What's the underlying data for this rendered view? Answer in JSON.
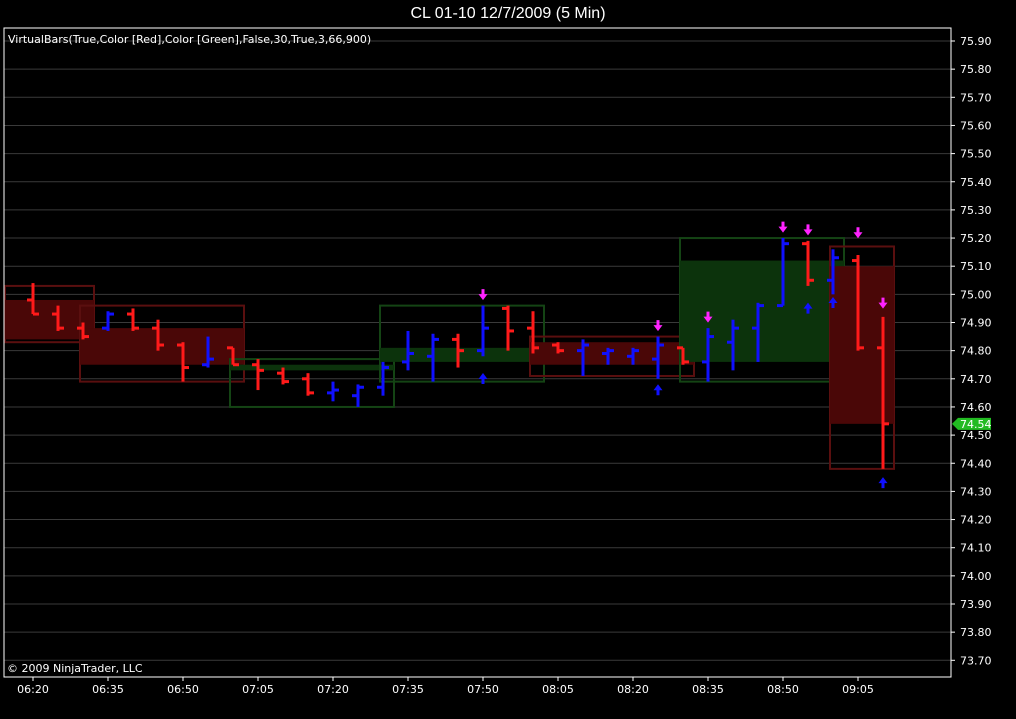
{
  "title": "CL 01-10  12/7/2009 (5 Min)",
  "indicator_label": "VirtualBars(True,Color [Red],Color [Green],False,30,True,3,66,900)",
  "copyright": "© 2009 NinjaTrader, LLC",
  "colors": {
    "background": "#000000",
    "grid": "#3a3a3a",
    "up_bar": "#1010ff",
    "down_bar": "#ff1a1a",
    "signal": "#ff22ff",
    "last_price_badge": "#22bb22"
  },
  "chart_data": {
    "type": "ohlc",
    "timeframe": "5 Min",
    "xlabel": "",
    "ylabel": "",
    "y_range": [
      73.65,
      75.95
    ],
    "y_ticks": [
      "75.90",
      "75.80",
      "75.70",
      "75.60",
      "75.50",
      "75.40",
      "75.30",
      "75.20",
      "75.10",
      "75.00",
      "74.90",
      "74.80",
      "74.70",
      "74.60",
      "74.50",
      "74.40",
      "74.30",
      "74.20",
      "74.10",
      "74.00",
      "73.90",
      "73.80",
      "73.70"
    ],
    "x_ticks": [
      "06:20",
      "06:35",
      "06:50",
      "07:05",
      "07:20",
      "07:35",
      "07:50",
      "08:05",
      "08:20",
      "08:35",
      "08:50",
      "09:05"
    ],
    "last_price": "74.54",
    "bars": [
      {
        "t": "06:20",
        "o": 74.98,
        "h": 75.04,
        "l": 74.93,
        "c": 74.93
      },
      {
        "t": "06:25",
        "o": 74.93,
        "h": 74.96,
        "l": 74.87,
        "c": 74.88
      },
      {
        "t": "06:30",
        "o": 74.88,
        "h": 74.9,
        "l": 74.84,
        "c": 74.85
      },
      {
        "t": "06:35",
        "o": 74.88,
        "h": 74.94,
        "l": 74.87,
        "c": 74.93
      },
      {
        "t": "06:40",
        "o": 74.93,
        "h": 74.95,
        "l": 74.87,
        "c": 74.88
      },
      {
        "t": "06:45",
        "o": 74.88,
        "h": 74.91,
        "l": 74.8,
        "c": 74.82
      },
      {
        "t": "06:50",
        "o": 74.82,
        "h": 74.83,
        "l": 74.69,
        "c": 74.74
      },
      {
        "t": "06:55",
        "o": 74.75,
        "h": 74.85,
        "l": 74.74,
        "c": 74.77
      },
      {
        "t": "07:00",
        "o": 74.81,
        "h": 74.81,
        "l": 74.75,
        "c": 74.75
      },
      {
        "t": "07:05",
        "o": 74.75,
        "h": 74.77,
        "l": 74.66,
        "c": 74.73
      },
      {
        "t": "07:10",
        "o": 74.72,
        "h": 74.74,
        "l": 74.68,
        "c": 74.69
      },
      {
        "t": "07:15",
        "o": 74.7,
        "h": 74.72,
        "l": 74.64,
        "c": 74.65
      },
      {
        "t": "07:20",
        "o": 74.65,
        "h": 74.69,
        "l": 74.62,
        "c": 74.66
      },
      {
        "t": "07:25",
        "o": 74.64,
        "h": 74.68,
        "l": 74.6,
        "c": 74.67
      },
      {
        "t": "07:30",
        "o": 74.67,
        "h": 74.76,
        "l": 74.64,
        "c": 74.74
      },
      {
        "t": "07:35",
        "o": 74.76,
        "h": 74.87,
        "l": 74.73,
        "c": 74.79
      },
      {
        "t": "07:40",
        "o": 74.78,
        "h": 74.86,
        "l": 74.69,
        "c": 74.84
      },
      {
        "t": "07:45",
        "o": 74.84,
        "h": 74.86,
        "l": 74.74,
        "c": 74.8
      },
      {
        "t": "07:50",
        "o": 74.8,
        "h": 74.96,
        "l": 74.78,
        "c": 74.88
      },
      {
        "t": "07:55",
        "o": 74.95,
        "h": 74.96,
        "l": 74.8,
        "c": 74.87
      },
      {
        "t": "08:00",
        "o": 74.88,
        "h": 74.94,
        "l": 74.79,
        "c": 74.81
      },
      {
        "t": "08:05",
        "o": 74.82,
        "h": 74.83,
        "l": 74.79,
        "c": 74.8
      },
      {
        "t": "08:10",
        "o": 74.8,
        "h": 74.84,
        "l": 74.71,
        "c": 74.82
      },
      {
        "t": "08:15",
        "o": 74.79,
        "h": 74.81,
        "l": 74.75,
        "c": 74.8
      },
      {
        "t": "08:20",
        "o": 74.78,
        "h": 74.81,
        "l": 74.75,
        "c": 74.8
      },
      {
        "t": "08:25",
        "o": 74.77,
        "h": 74.85,
        "l": 74.7,
        "c": 74.82
      },
      {
        "t": "08:30",
        "o": 74.81,
        "h": 74.81,
        "l": 74.75,
        "c": 74.76
      },
      {
        "t": "08:35",
        "o": 74.76,
        "h": 74.88,
        "l": 74.69,
        "c": 74.85
      },
      {
        "t": "08:40",
        "o": 74.83,
        "h": 74.91,
        "l": 74.73,
        "c": 74.88
      },
      {
        "t": "08:45",
        "o": 74.88,
        "h": 74.97,
        "l": 74.76,
        "c": 74.96
      },
      {
        "t": "08:50",
        "o": 74.96,
        "h": 75.2,
        "l": 74.96,
        "c": 75.18
      },
      {
        "t": "08:55",
        "o": 75.18,
        "h": 75.19,
        "l": 75.03,
        "c": 75.05
      },
      {
        "t": "09:00",
        "o": 75.05,
        "h": 75.16,
        "l": 75.0,
        "c": 75.13
      },
      {
        "t": "09:05",
        "o": 75.12,
        "h": 75.14,
        "l": 74.8,
        "c": 74.81
      },
      {
        "t": "09:10",
        "o": 74.81,
        "h": 74.92,
        "l": 74.38,
        "c": 74.54
      }
    ],
    "virtual_bars": [
      {
        "start": "06:20",
        "end": "06:30",
        "h": 75.03,
        "l": 74.83,
        "o": 74.98,
        "c": 74.84,
        "direction": "down"
      },
      {
        "start": "06:35",
        "end": "07:00",
        "h": 74.96,
        "l": 74.69,
        "o": 74.88,
        "c": 74.75,
        "direction": "down"
      },
      {
        "start": "07:05",
        "end": "07:30",
        "h": 74.77,
        "l": 74.6,
        "o": 74.75,
        "c": 74.73,
        "direction": "up"
      },
      {
        "start": "07:35",
        "end": "08:00",
        "h": 74.96,
        "l": 74.69,
        "o": 74.76,
        "c": 74.81,
        "direction": "up"
      },
      {
        "start": "08:05",
        "end": "08:30",
        "h": 74.85,
        "l": 74.71,
        "o": 74.83,
        "c": 74.75,
        "direction": "down"
      },
      {
        "start": "08:35",
        "end": "09:00",
        "h": 75.2,
        "l": 74.69,
        "o": 74.76,
        "c": 75.12,
        "direction": "up"
      },
      {
        "start": "09:05",
        "end": "09:10",
        "h": 75.17,
        "l": 74.38,
        "o": 75.1,
        "c": 74.54,
        "direction": "down"
      }
    ],
    "signals": [
      {
        "t": "07:50",
        "kind": "down-arrow",
        "price": 74.99
      },
      {
        "t": "07:50",
        "kind": "up-arrow",
        "price": 74.71
      },
      {
        "t": "08:25",
        "kind": "down-arrow",
        "price": 74.88
      },
      {
        "t": "08:25",
        "kind": "up-arrow",
        "price": 74.67
      },
      {
        "t": "08:35",
        "kind": "down-arrow",
        "price": 74.91
      },
      {
        "t": "08:50",
        "kind": "down-arrow",
        "price": 75.23
      },
      {
        "t": "08:55",
        "kind": "down-arrow",
        "price": 75.22
      },
      {
        "t": "08:55",
        "kind": "up-arrow",
        "price": 74.96
      },
      {
        "t": "09:00",
        "kind": "up-arrow",
        "price": 74.98
      },
      {
        "t": "09:05",
        "kind": "down-arrow",
        "price": 75.21
      },
      {
        "t": "09:10",
        "kind": "down-arrow",
        "price": 74.96
      },
      {
        "t": "09:10",
        "kind": "up-arrow",
        "price": 74.34
      }
    ]
  }
}
